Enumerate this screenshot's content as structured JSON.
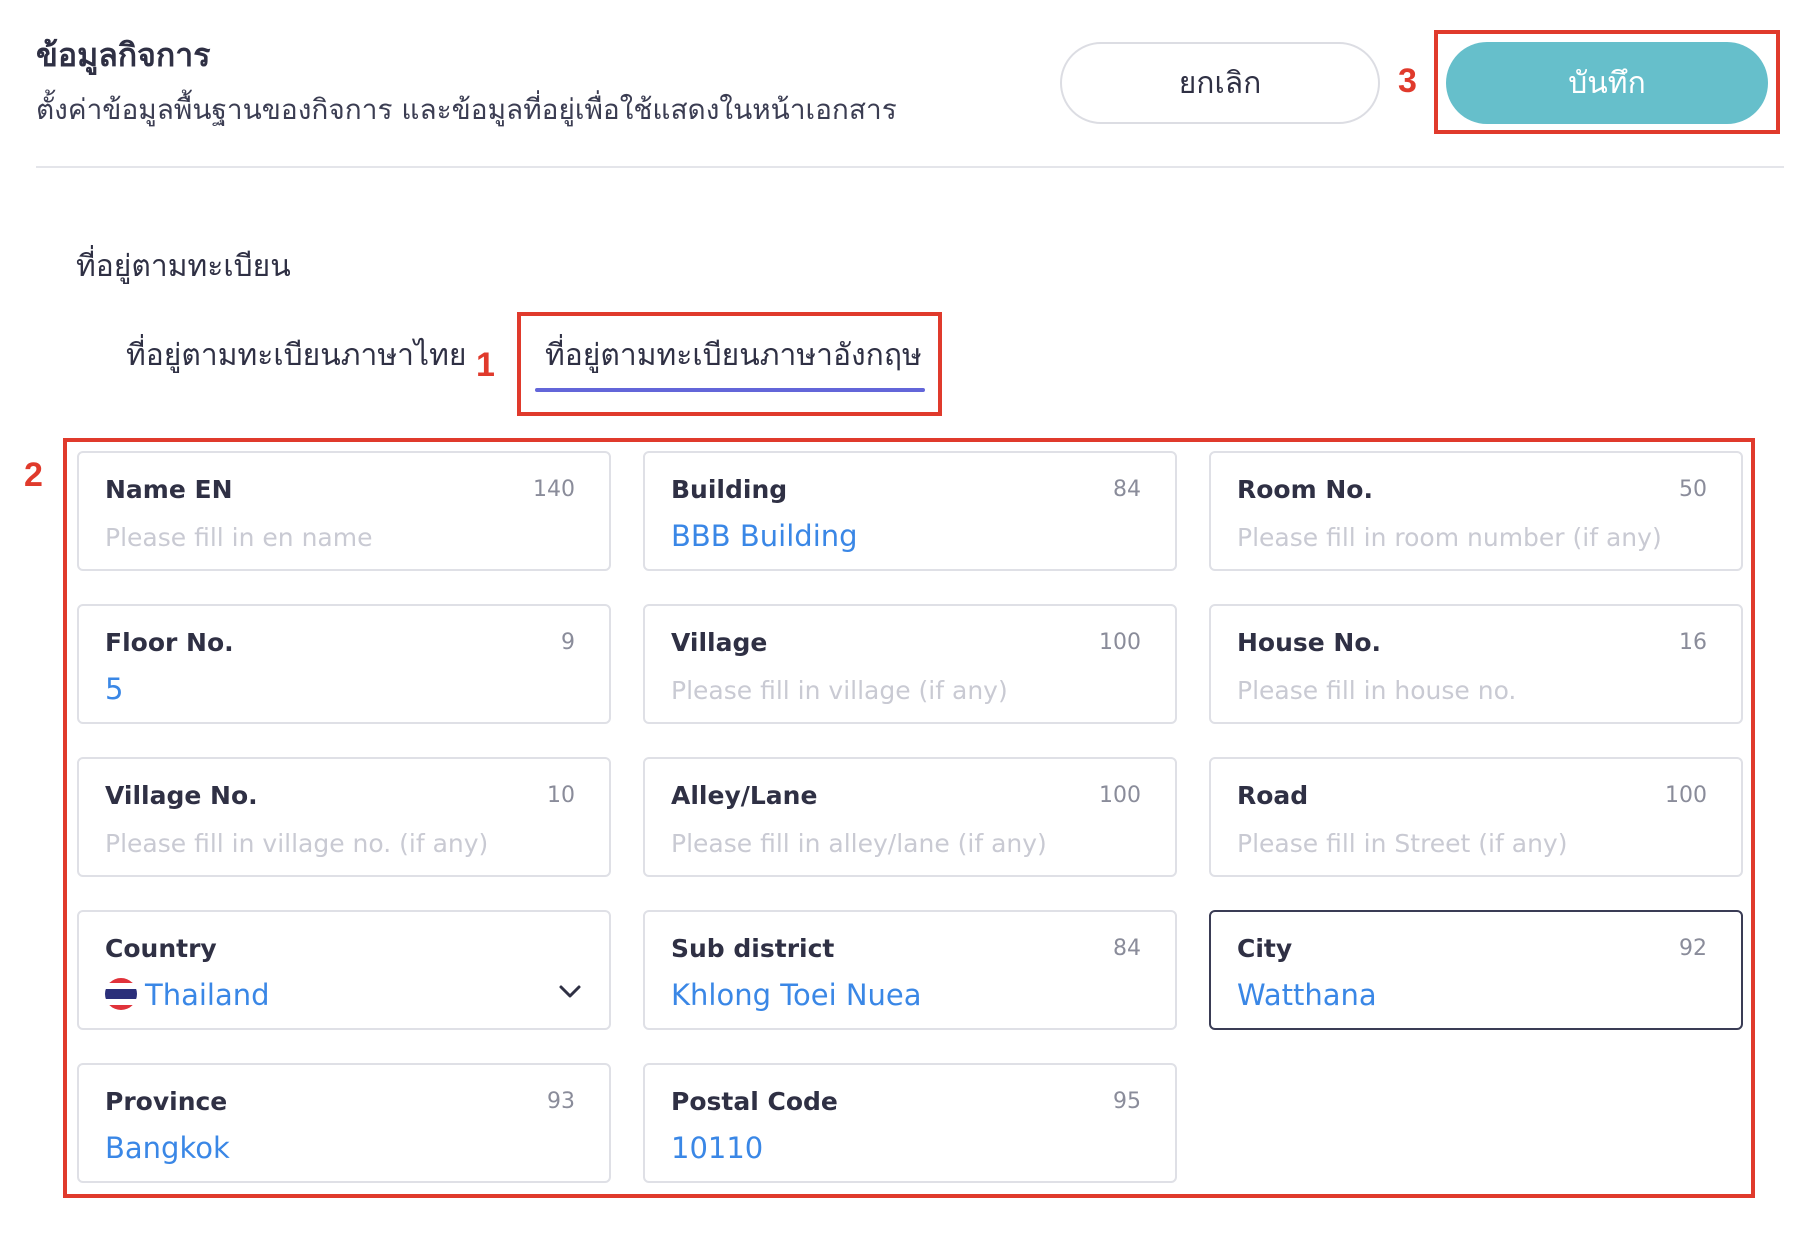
{
  "header": {
    "title": "ข้อมูลกิจการ",
    "subtitle": "ตั้งค่าข้อมูลพื้นฐานของกิจการ และข้อมูลที่อยู่เพื่อใช้แสดงในหน้าเอกสาร",
    "cancel_label": "ยกเลิก",
    "save_label": "บันทึก"
  },
  "section": {
    "title": "ที่อยู่ตามทะเบียน"
  },
  "tabs": [
    {
      "label": "ที่อยู่ตามทะเบียนภาษาไทย",
      "active": false
    },
    {
      "label": "ที่อยู่ตามทะเบียนภาษาอังกฤษ",
      "active": true
    }
  ],
  "callouts": [
    "1",
    "2",
    "3"
  ],
  "fields": {
    "name_en": {
      "label": "Name EN",
      "count": "140",
      "placeholder": "Please fill in en name"
    },
    "building": {
      "label": "Building",
      "count": "84",
      "value": "BBB Building"
    },
    "room_no": {
      "label": "Room No.",
      "count": "50",
      "placeholder": "Please fill in room number (if any)"
    },
    "floor_no": {
      "label": "Floor No.",
      "count": "9",
      "value": "5"
    },
    "village": {
      "label": "Village",
      "count": "100",
      "placeholder": "Please fill in village (if any)"
    },
    "house_no": {
      "label": "House No.",
      "count": "16",
      "placeholder": "Please fill in house no."
    },
    "village_no": {
      "label": "Village No.",
      "count": "10",
      "placeholder": "Please fill in village no. (if any)"
    },
    "alley_lane": {
      "label": "Alley/Lane",
      "count": "100",
      "placeholder": "Please fill in alley/lane (if any)"
    },
    "road": {
      "label": "Road",
      "count": "100",
      "placeholder": "Please fill in Street (if any)"
    },
    "country": {
      "label": "Country",
      "value": "Thailand",
      "icon": "thailand-flag-icon"
    },
    "sub_district": {
      "label": "Sub district",
      "count": "84",
      "value": "Khlong Toei Nuea"
    },
    "city": {
      "label": "City",
      "count": "92",
      "value": "Watthana"
    },
    "province": {
      "label": "Province",
      "count": "93",
      "value": "Bangkok"
    },
    "postal_code": {
      "label": "Postal Code",
      "count": "95",
      "value": "10110"
    }
  },
  "colors": {
    "accent": "#66bfcb",
    "tab_underline": "#6366d9",
    "value_text": "#3a87e6",
    "callout": "#e03a2c"
  }
}
